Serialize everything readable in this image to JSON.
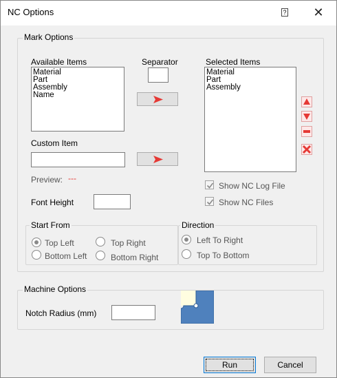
{
  "window": {
    "title": "NC Options",
    "help_glyph": "?",
    "close_glyph": "✕"
  },
  "mark_options": {
    "legend": "Mark Options",
    "available_label": "Available Items",
    "available_items": [
      "Material",
      "Part",
      "Assembly",
      "Name"
    ],
    "separator_label": "Separator",
    "separator_value": "",
    "selected_label": "Selected Items",
    "selected_items": [
      "Material",
      "Part",
      "Assembly"
    ],
    "custom_label": "Custom Item",
    "custom_value": "",
    "preview_label": "Preview:",
    "preview_value": "---",
    "font_height_label": "Font Height",
    "font_height_value": "",
    "show_log_label": "Show NC Log File",
    "show_log_checked": true,
    "show_files_label": "Show NC Files",
    "show_files_checked": true,
    "accent_color": "#e53935"
  },
  "start_from": {
    "legend": "Start From",
    "options": [
      "Top Left",
      "Top Right",
      "Bottom Left",
      "Bottom Right"
    ],
    "selected": "Top Left"
  },
  "direction": {
    "legend": "Direction",
    "options": [
      "Left To Right",
      "Top To Bottom"
    ],
    "selected": "Left To Right"
  },
  "machine_options": {
    "legend": "Machine Options",
    "notch_label": "Notch Radius (mm)",
    "notch_value": "",
    "preview_color": "#4f81bd"
  },
  "footer": {
    "run_label": "Run",
    "cancel_label": "Cancel"
  }
}
